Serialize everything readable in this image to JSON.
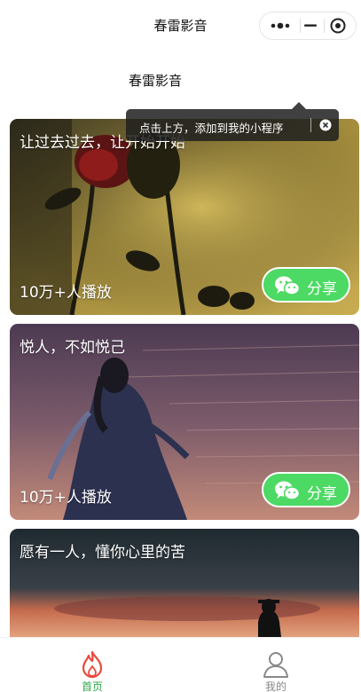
{
  "nav_bar": {
    "title": "春雷影音"
  },
  "header": {
    "title": "春雷影音"
  },
  "tooltip": {
    "text": "点击上方，添加到我的小程序"
  },
  "cards": [
    {
      "title": "让过去过去，让开始开始",
      "plays": "10万+人播放",
      "share_label": "分享",
      "icon": "wechat-icon"
    },
    {
      "title": "悦人，不如悦己",
      "plays": "10万+人播放",
      "share_label": "分享",
      "icon": "wechat-icon"
    },
    {
      "title": "愿有一人，懂你心里的苦"
    }
  ],
  "tab_bar": {
    "items": [
      {
        "label": "首页",
        "icon": "flame-icon",
        "active": true
      },
      {
        "label": "我的",
        "icon": "user-icon",
        "active": false
      }
    ]
  },
  "colors": {
    "accent_green": "#4cd964",
    "active_tab": "#2ea84b",
    "flame": "#e94a3c",
    "inactive_tab": "#888888"
  }
}
